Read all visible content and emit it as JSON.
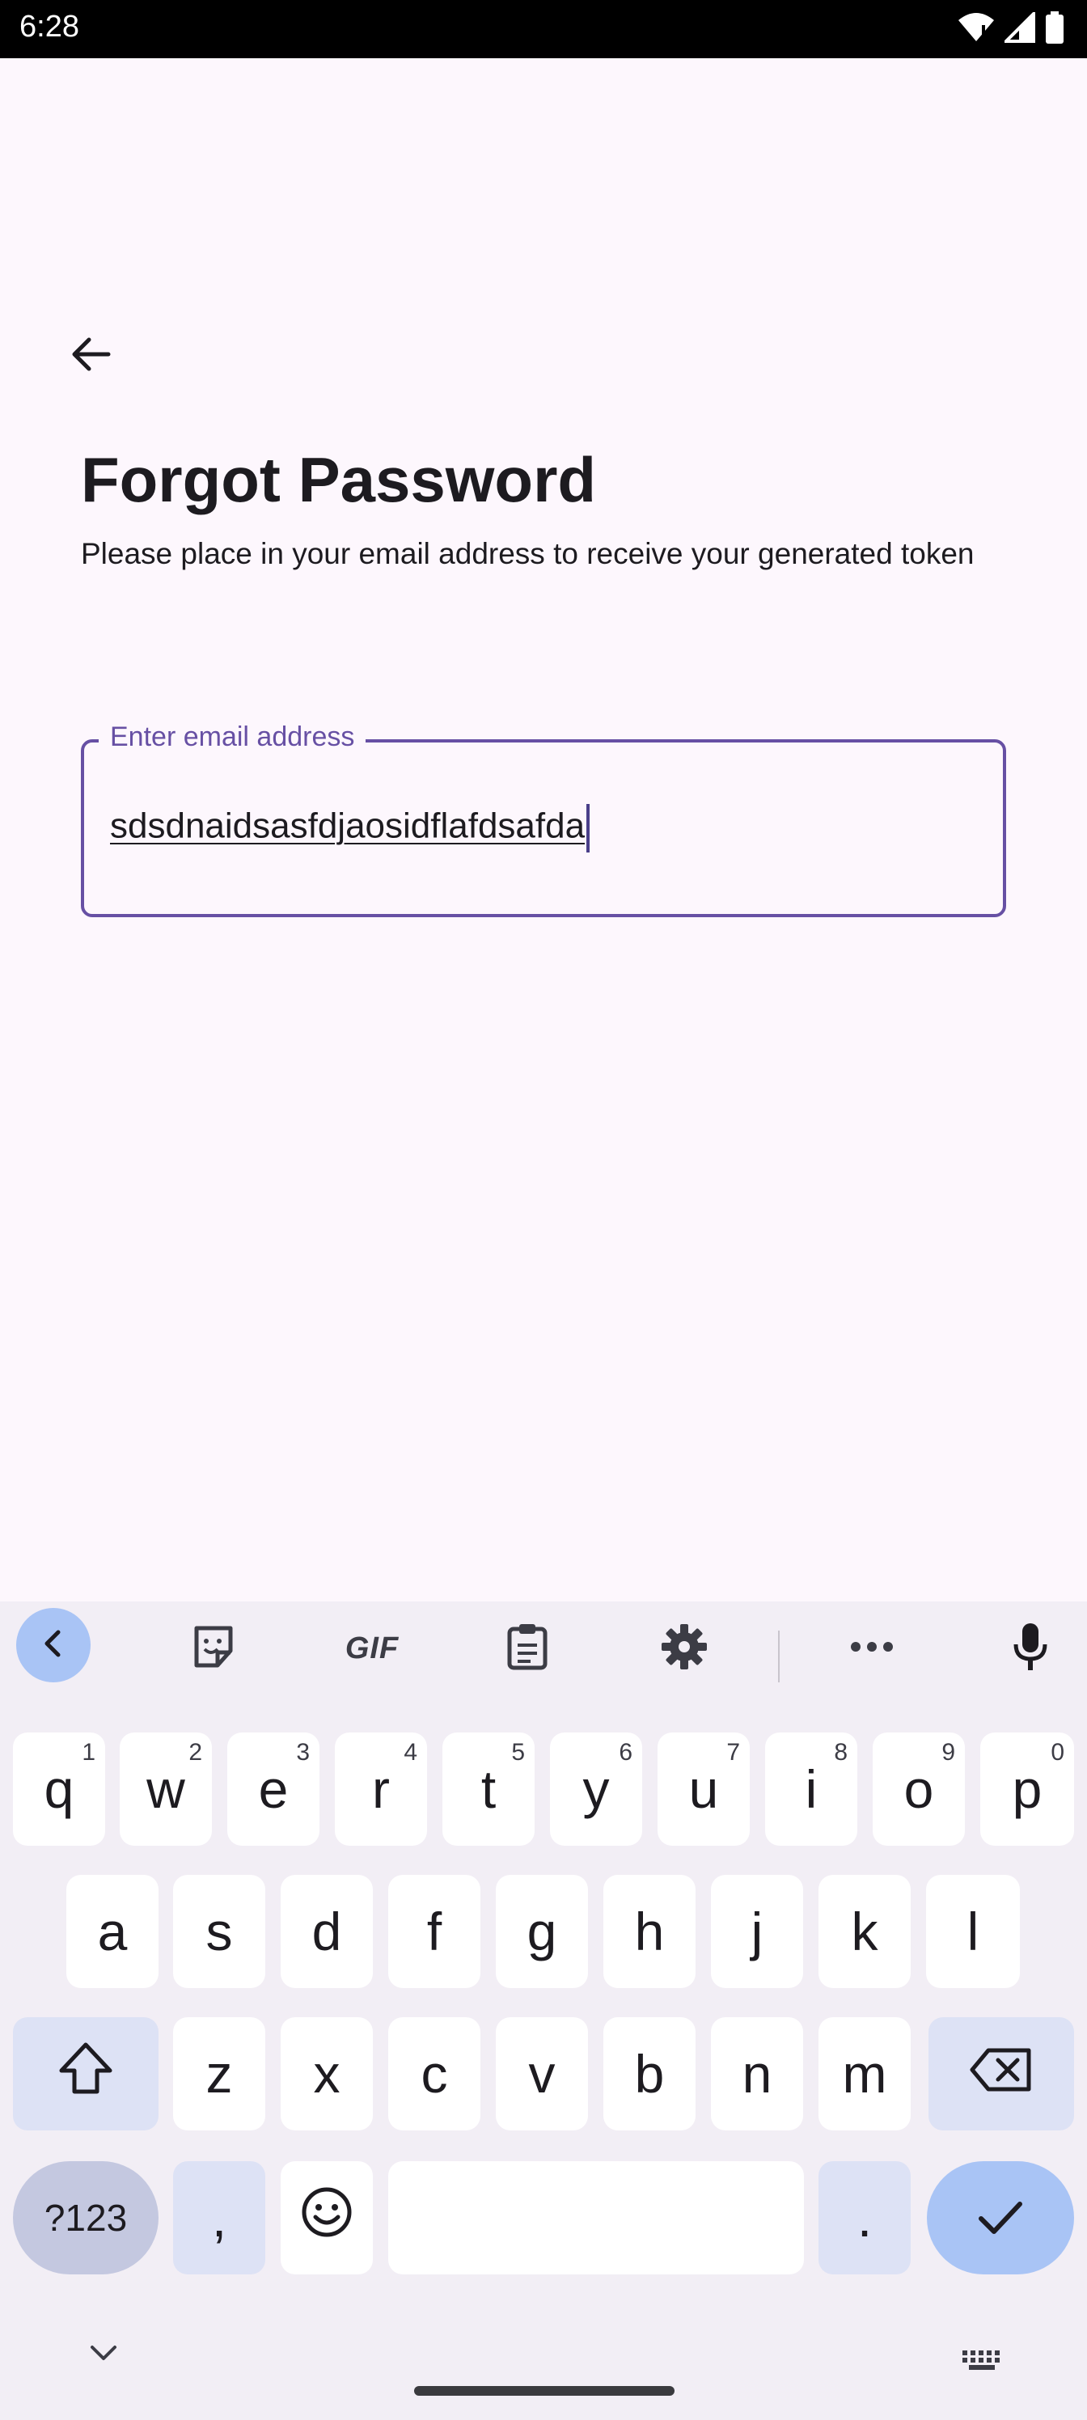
{
  "status_bar": {
    "time": "6:28"
  },
  "page": {
    "title": "Forgot Password",
    "subtitle": "Please place in your email address to receive your generated token"
  },
  "email_field": {
    "label": "Enter email address",
    "value": "sdsdnaidsasfdjaosidflafdsafda"
  },
  "keyboard": {
    "toolbar": {
      "gif_label": "GIF"
    },
    "row1": [
      {
        "k": "q",
        "h": "1"
      },
      {
        "k": "w",
        "h": "2"
      },
      {
        "k": "e",
        "h": "3"
      },
      {
        "k": "r",
        "h": "4"
      },
      {
        "k": "t",
        "h": "5"
      },
      {
        "k": "y",
        "h": "6"
      },
      {
        "k": "u",
        "h": "7"
      },
      {
        "k": "i",
        "h": "8"
      },
      {
        "k": "o",
        "h": "9"
      },
      {
        "k": "p",
        "h": "0"
      }
    ],
    "row2": [
      "a",
      "s",
      "d",
      "f",
      "g",
      "h",
      "j",
      "k",
      "l"
    ],
    "row3": [
      "z",
      "x",
      "c",
      "v",
      "b",
      "n",
      "m"
    ],
    "symbols_label": "?123",
    "comma_label": ",",
    "period_label": "."
  }
}
